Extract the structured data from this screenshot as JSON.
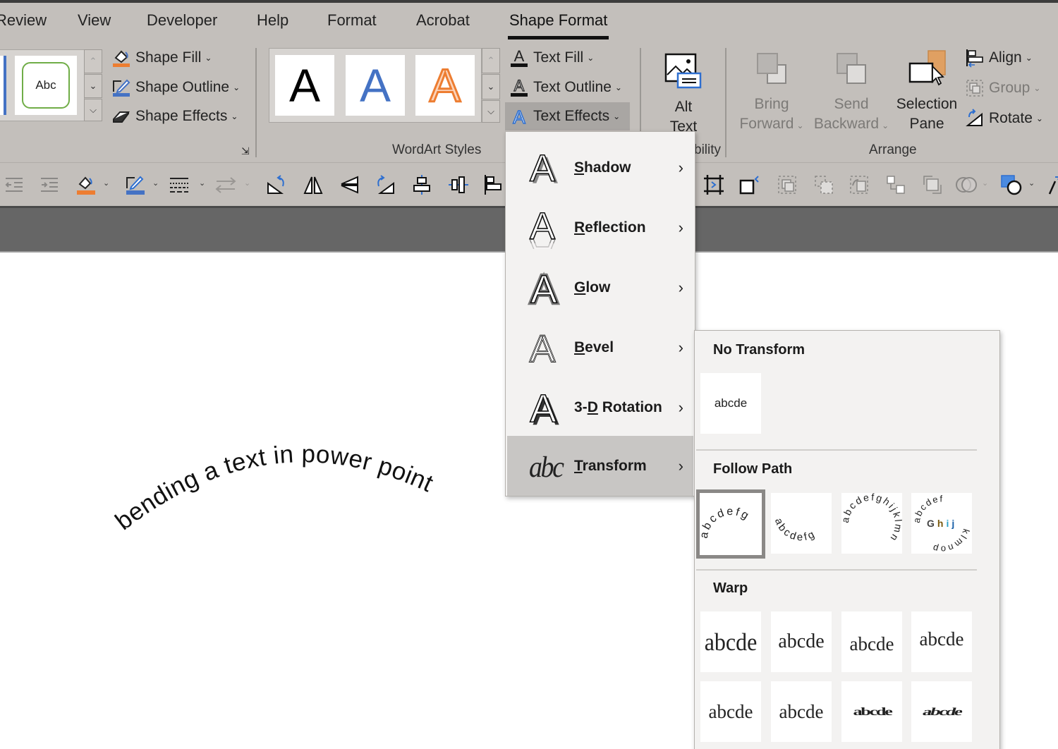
{
  "tabs": [
    {
      "label": "Review",
      "active": false
    },
    {
      "label": "View",
      "active": false
    },
    {
      "label": "Developer",
      "active": false
    },
    {
      "label": "Help",
      "active": false
    },
    {
      "label": "Format",
      "active": false
    },
    {
      "label": "Acrobat",
      "active": false
    },
    {
      "label": "Shape Format",
      "active": true
    }
  ],
  "ribbon": {
    "shape_styles": {
      "preview_label": "Abc",
      "shape_fill": "Shape Fill",
      "shape_outline": "Shape Outline",
      "shape_effects": "Shape Effects"
    },
    "wordart": {
      "group_label": "WordArt Styles",
      "style_letters": [
        "A",
        "A",
        "A"
      ],
      "text_fill": "Text Fill",
      "text_outline": "Text Outline",
      "text_effects": "Text Effects"
    },
    "accessibility": {
      "alt_text_line1": "Alt",
      "alt_text_line2": "Text",
      "group_label_partial": "bility"
    },
    "arrange": {
      "group_label": "Arrange",
      "bring_forward_line1": "Bring",
      "bring_forward_line2": "Forward",
      "send_backward_line1": "Send",
      "send_backward_line2": "Backward",
      "selection_pane_line1": "Selection",
      "selection_pane_line2": "Pane",
      "align": "Align",
      "group": "Group",
      "rotate": "Rotate"
    }
  },
  "text_effects_menu": {
    "items": [
      {
        "label": "Shadow",
        "mnemonic": "S",
        "rest": "hadow",
        "icon": "shadow-a-icon"
      },
      {
        "label": "Reflection",
        "mnemonic": "R",
        "rest": "eflection",
        "icon": "reflection-a-icon"
      },
      {
        "label": "Glow",
        "mnemonic": "G",
        "rest": "low",
        "icon": "glow-a-icon"
      },
      {
        "label": "Bevel",
        "mnemonic": "B",
        "rest": "evel",
        "icon": "bevel-a-icon"
      },
      {
        "label": "3-D Rotation",
        "prefix": "3-",
        "mnemonic": "D",
        "rest": " Rotation",
        "icon": "3d-rotation-a-icon"
      },
      {
        "label": "Transform",
        "mnemonic": "T",
        "rest": "ransform",
        "icon": "transform-abc-icon",
        "active": true
      }
    ]
  },
  "transform_submenu": {
    "no_transform_heading": "No Transform",
    "no_transform_sample": "abcde",
    "follow_path_heading": "Follow Path",
    "follow_path_samples": [
      {
        "text": "abcdefg",
        "name": "arch",
        "selected": true
      },
      {
        "text": "abcdefg",
        "name": "arch-down",
        "selected": false
      },
      {
        "text": "abcdefghijklmn",
        "name": "circle",
        "selected": false
      },
      {
        "text": "abcdefGhijklmnop",
        "name": "button",
        "selected": false
      }
    ],
    "warp_heading": "Warp",
    "warp_samples": [
      "abcde",
      "abcde",
      "abcde",
      "abcde",
      "abcde",
      "abcde",
      "abcde",
      "abcde"
    ]
  },
  "slide": {
    "curved_text": "bending a text in power point"
  },
  "colors": {
    "ribbon_bg": "#c3bfbb",
    "accent_orange": "#ed7d31",
    "accent_blue": "#4472c4",
    "green_outline": "#70ad47",
    "dark_bar": "#666666"
  }
}
